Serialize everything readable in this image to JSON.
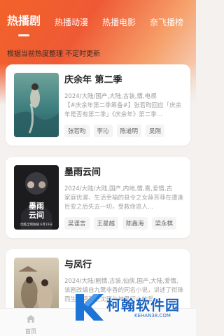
{
  "header": {
    "tabs": [
      {
        "label": "热播剧",
        "active": true
      },
      {
        "label": "热播动漫",
        "active": false
      },
      {
        "label": "热播电影",
        "active": false
      },
      {
        "label": "奈飞播榜",
        "active": false
      }
    ],
    "subtitle": "根据当前热度整理 不定时更新"
  },
  "shows": [
    {
      "title": "庆余年 第二季",
      "meta": "2024/大陆/国产,大陆,古装,情,电视",
      "desc": "【#庆余年第二季筹备#】张若昀回应「庆余年是否有第二季」《庆余年》第二季...",
      "tags": [
        "张若昀",
        "李沁",
        "陈道明",
        "吴刚"
      ]
    },
    {
      "title": "墨雨云间",
      "meta": "2024/大陆/大陆,国产,内地,情,喜,爱情,古",
      "desc": "家庭优渥、生活幸福的县令之女薛芳菲在遭逢巨变之后失去一切，受救命恩人...",
      "tags": [
        "吴谨言",
        "王星越",
        "陈鑫海",
        "梁永棋"
      ],
      "poster_text": [
        "墨雨",
        "云间"
      ],
      "poster_caption": "优酷全网独播 6月19日"
    },
    {
      "title": "与凤行",
      "meta": "2024/大陆/剧情,古装,仙侠,国产,大陆,爱情,",
      "desc": "该剧改编自九鹭非香的同名小说，讲述了衔珠而生的碧苍王沈璃与神君行止的爱...",
      "tags": []
    }
  ],
  "bottom_nav": {
    "home_label": "首页"
  },
  "watermark": {
    "text": "柯翰软件园",
    "url": "KEHAN38.COM"
  },
  "colors": {
    "accent": "#f2622a",
    "brand_blue": "#1a63c2"
  }
}
